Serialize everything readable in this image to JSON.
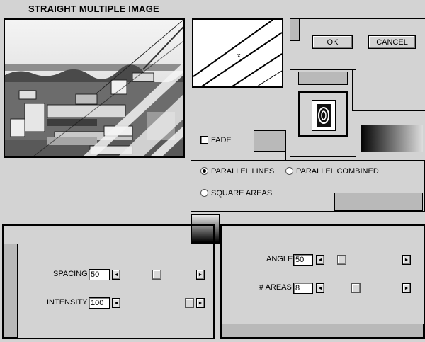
{
  "window": {
    "title": "STRAIGHT MULTIPLE IMAGE"
  },
  "buttons": {
    "ok": "OK",
    "cancel": "CANCEL"
  },
  "fade": {
    "label": "FADE",
    "checked": false
  },
  "mode": {
    "options": [
      "PARALLEL LINES",
      "PARALLEL COMBINED",
      "SQUARE AREAS"
    ],
    "selected": "PARALLEL LINES"
  },
  "controls": {
    "spacing": {
      "label": "SPACING",
      "value": "50"
    },
    "intensity": {
      "label": "INTENSITY",
      "value": "100"
    },
    "angle": {
      "label": "ANGLE",
      "value": "50"
    },
    "areas": {
      "label": "# AREAS",
      "value": "8"
    }
  },
  "icons": {
    "left_arrow": "◄",
    "right_arrow": "►"
  },
  "colors": {
    "panel": "#d3d3d3",
    "block": "#b9b9b9"
  }
}
